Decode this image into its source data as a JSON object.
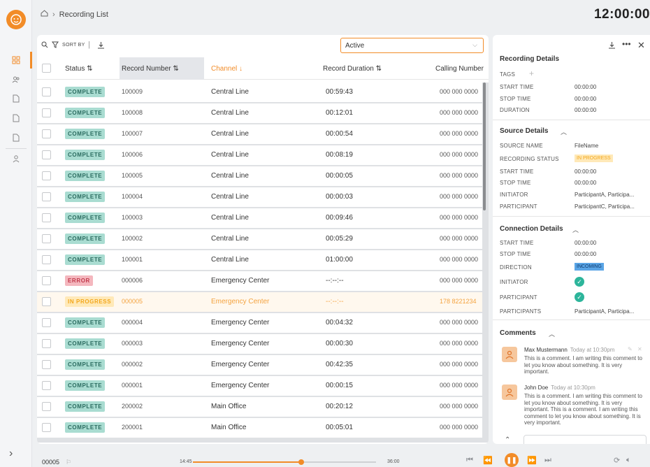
{
  "breadcrumb": {
    "page": "Recording List"
  },
  "clock": "12:00:00",
  "toolbar": {
    "sort_label": "SORT BY",
    "filter_value": "Active"
  },
  "table": {
    "columns": [
      "Status",
      "Record Number",
      "Channel",
      "Record Duration",
      "Calling Number"
    ],
    "rows": [
      {
        "status": "COMPLETE",
        "number": "100009",
        "channel": "Central Line",
        "duration": "00:59:43",
        "calling": "000 000 0000"
      },
      {
        "status": "COMPLETE",
        "number": "100008",
        "channel": "Central Line",
        "duration": "00:12:01",
        "calling": "000 000 0000"
      },
      {
        "status": "COMPLETE",
        "number": "100007",
        "channel": "Central Line",
        "duration": "00:00:54",
        "calling": "000 000 0000"
      },
      {
        "status": "COMPLETE",
        "number": "100006",
        "channel": "Central Line",
        "duration": "00:08:19",
        "calling": "000 000 0000"
      },
      {
        "status": "COMPLETE",
        "number": "100005",
        "channel": "Central Line",
        "duration": "00:00:05",
        "calling": "000 000 0000"
      },
      {
        "status": "COMPLETE",
        "number": "100004",
        "channel": "Central Line",
        "duration": "00:00:03",
        "calling": "000 000 0000"
      },
      {
        "status": "COMPLETE",
        "number": "100003",
        "channel": "Central Line",
        "duration": "00:09:46",
        "calling": "000 000 0000"
      },
      {
        "status": "COMPLETE",
        "number": "100002",
        "channel": "Central Line",
        "duration": "00:05:29",
        "calling": "000 000 0000"
      },
      {
        "status": "COMPLETE",
        "number": "100001",
        "channel": "Central Line",
        "duration": "01:00:00",
        "calling": "000 000 0000"
      },
      {
        "status": "ERROR",
        "number": "000006",
        "channel": "Emergency Center",
        "duration": "--:--:--",
        "calling": "000 000 0000"
      },
      {
        "status": "IN PROGRESS",
        "number": "000005",
        "channel": "Emergency Center",
        "duration": "--:--:--",
        "calling": "178 8221234"
      },
      {
        "status": "COMPLETE",
        "number": "000004",
        "channel": "Emergency Center",
        "duration": "00:04:32",
        "calling": "000 000 0000"
      },
      {
        "status": "COMPLETE",
        "number": "000003",
        "channel": "Emergency Center",
        "duration": "00:00:30",
        "calling": "000 000 0000"
      },
      {
        "status": "COMPLETE",
        "number": "000002",
        "channel": "Emergency Center",
        "duration": "00:42:35",
        "calling": "000 000 0000"
      },
      {
        "status": "COMPLETE",
        "number": "000001",
        "channel": "Emergency Center",
        "duration": "00:00:15",
        "calling": "000 000 0000"
      },
      {
        "status": "COMPLETE",
        "number": "200002",
        "channel": "Main Office",
        "duration": "00:20:12",
        "calling": "000 000 0000"
      },
      {
        "status": "COMPLETE",
        "number": "200001",
        "channel": "Main Office",
        "duration": "00:05:01",
        "calling": "000 000 0000"
      }
    ]
  },
  "details": {
    "recording": {
      "title": "Recording Details",
      "tags_label": "TAGS",
      "start_label": "START TIME",
      "start": "00:00:00",
      "stop_label": "STOP TIME",
      "stop": "00:00:00",
      "duration_label": "DURATION",
      "duration": "00:00:00"
    },
    "source": {
      "title": "Source Details",
      "name_label": "SOURCE NAME",
      "name": "FileName",
      "status_label": "RECORDING STATUS",
      "status": "IN PROGRESS",
      "start_label": "START TIME",
      "start": "00:00:00",
      "stop_label": "STOP TIME",
      "stop": "00:00:00",
      "initiator_label": "INITIATOR",
      "initiator": "ParticipantA, Participa...",
      "participant_label": "PARTICIPANT",
      "participant": "ParticipantC, Participa..."
    },
    "connection": {
      "title": "Connection Details",
      "start_label": "START TIME",
      "start": "00:00:00",
      "stop_label": "STOP TIME",
      "stop": "00:00:00",
      "direction_label": "DIRECTION",
      "direction": "INCOMING",
      "initiator_label": "INITIATOR",
      "participant_label": "PARTICIPANT",
      "participants_label": "PARTICIPANTS",
      "participants": "ParticipantA, Participa..."
    },
    "comments": {
      "title": "Comments",
      "items": [
        {
          "author": "Max Mustermann",
          "time": "Today at 10:30pm",
          "text": "This is a comment. I am writing this comment to let you know about something. It is very important."
        },
        {
          "author": "John Doe",
          "time": "Today at 10:30pm",
          "text": "This is a comment. I am writing this comment to let you know about something. It is very important. This is a comment. I am writing this comment to let you know about something. It is very important."
        }
      ]
    }
  },
  "player": {
    "record": "00005",
    "current": "14:45",
    "total": "36:00",
    "progress": 0.59
  }
}
